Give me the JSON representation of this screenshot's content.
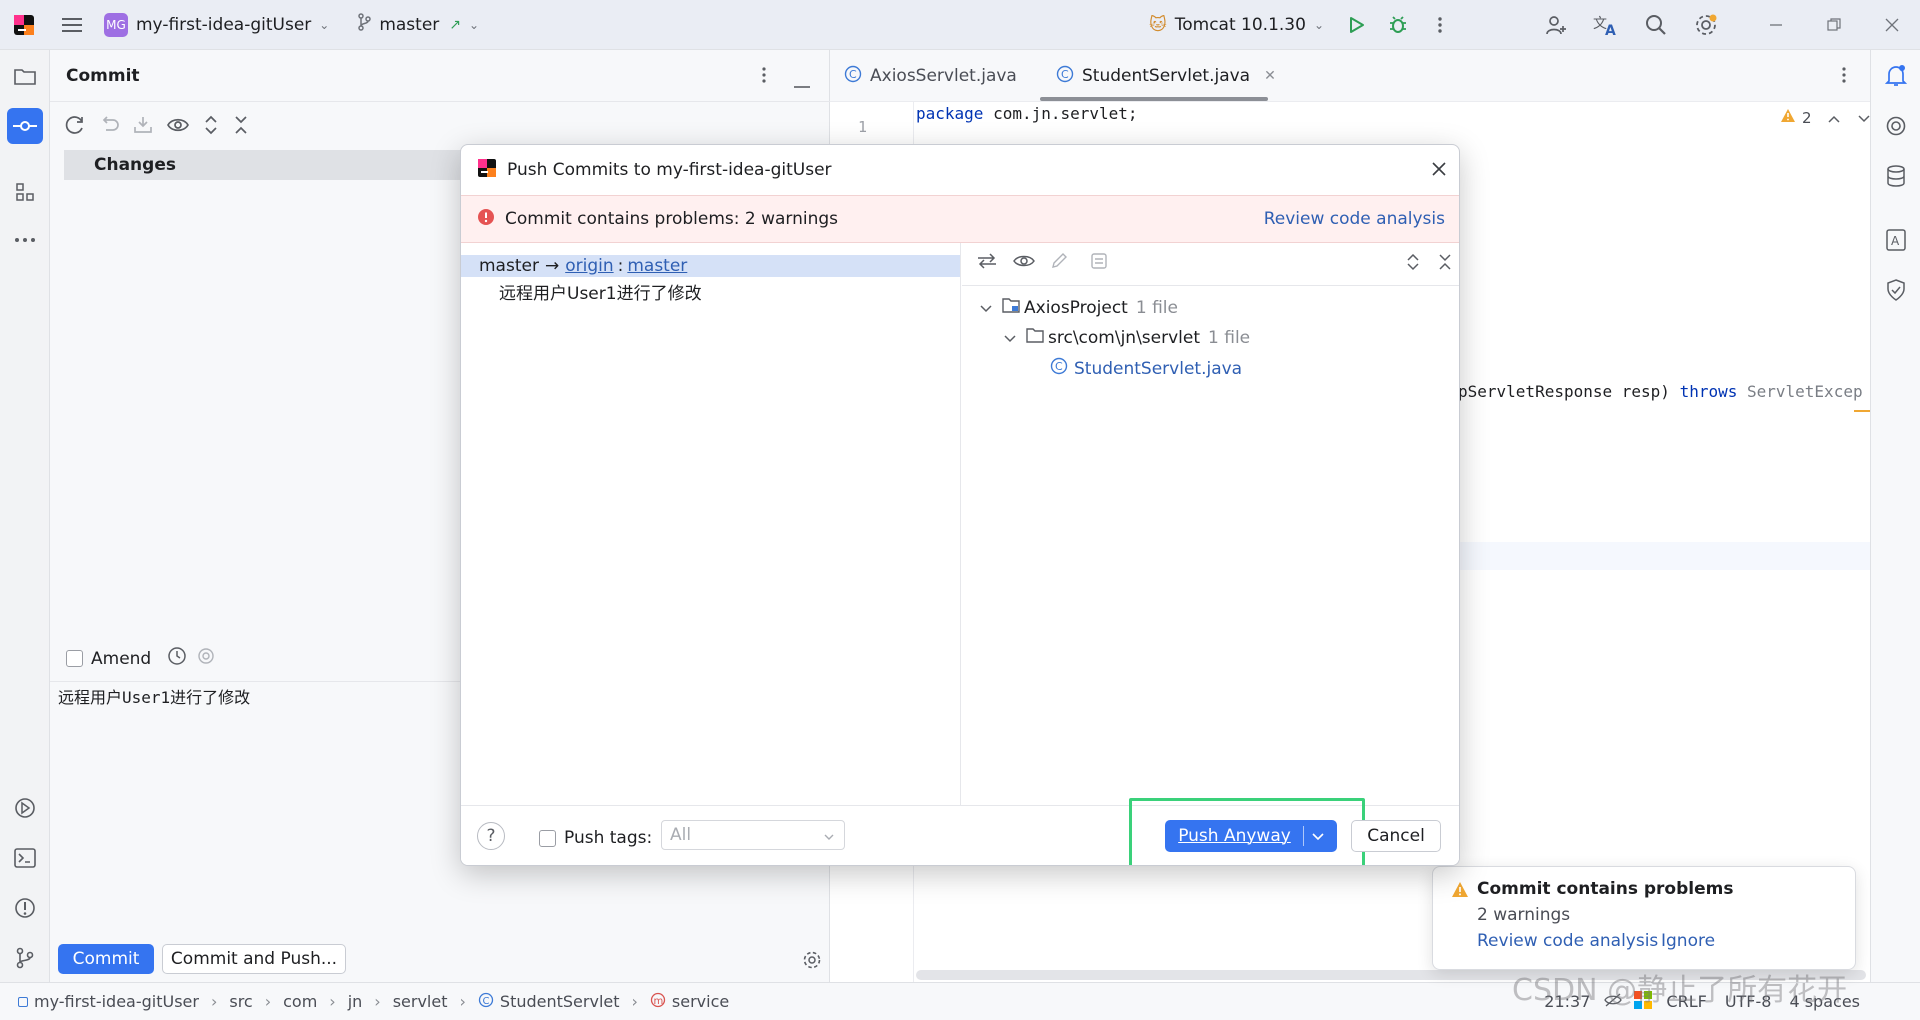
{
  "titlebar": {
    "project_badge": "MG",
    "project_name": "my-first-idea-gitUser",
    "branch": "master",
    "run_config": "Tomcat 10.1.30"
  },
  "commit_panel": {
    "title": "Commit",
    "changes_label": "Changes",
    "amend_label": "Amend",
    "commit_message": "远程用户User1进行了修改",
    "commit_button": "Commit",
    "commit_push_button": "Commit and Push..."
  },
  "editor": {
    "tabs": [
      {
        "label": "AxiosServlet.java"
      },
      {
        "label": "StudentServlet.java"
      }
    ],
    "line1_number": "1",
    "line1_keyword": "package",
    "line1_rest": " com.jn.servlet;",
    "warnings_count": "2",
    "code_fragment_a": "pServletResponse resp) ",
    "code_fragment_kw": "throws",
    "code_fragment_b": " ServletExcep"
  },
  "modal": {
    "title": "Push Commits to my-first-idea-gitUser",
    "warning_text": "Commit contains problems: 2 warnings",
    "review_link": "Review code analysis",
    "push_target": {
      "local": "master",
      "arrow": "→",
      "remote": "origin",
      "sep": ":",
      "remote_branch": "master"
    },
    "commit_entry": "远程用户User1进行了修改",
    "tree": {
      "root": "AxiosProject",
      "root_count": "1 file",
      "folder": "src\\com\\jn\\servlet",
      "folder_count": "1 file",
      "file": "StudentServlet.java"
    },
    "push_tags_label": "Push tags:",
    "push_tags_value": "All",
    "push_anyway": "Push Anyway",
    "cancel": "Cancel"
  },
  "notification": {
    "title": "Commit contains problems",
    "subtitle": "2 warnings",
    "link": "Review code analysis",
    "ignore": "Ignore"
  },
  "statusbar": {
    "crumbs": [
      "my-first-idea-gitUser",
      "src",
      "com",
      "jn",
      "servlet",
      "StudentServlet",
      "service"
    ],
    "position": "21:37",
    "line_sep": "CRLF",
    "encoding": "UTF-8",
    "indent": "4 spaces",
    "watermark": "CSDN @静止了所有花开"
  },
  "colors": {
    "accent": "#3574f0",
    "highlight_box": "#3ad17a",
    "warning_bg": "#fff0f0",
    "error_red": "#e55353"
  }
}
